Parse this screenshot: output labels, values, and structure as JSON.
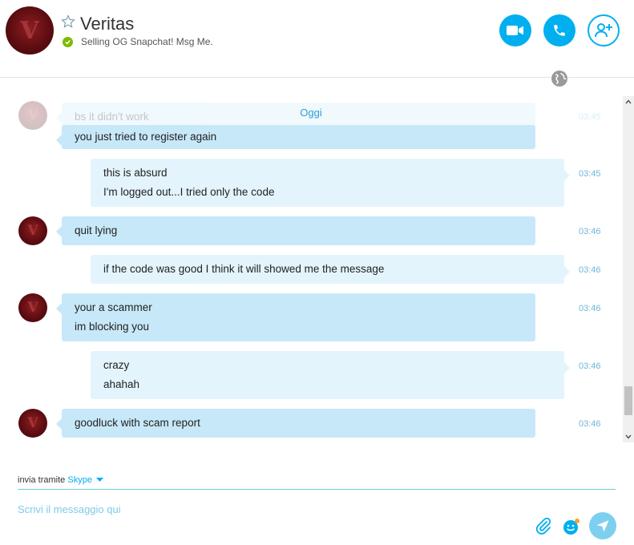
{
  "contact": {
    "name": "Veritas",
    "mood": "Selling OG Snapchat! Msg Me.",
    "avatar_letter": "V",
    "status": "online"
  },
  "header_actions": {
    "video_call": "video-call",
    "audio_call": "audio-call",
    "add_people": "add-people"
  },
  "chat": {
    "day_separator": "Oggi",
    "messages": [
      {
        "dir": "in",
        "lines": [
          "bs it didn't work"
        ],
        "time": "03:45",
        "faded": true
      },
      {
        "dir": "in",
        "lines": [
          "you just tried to register again"
        ],
        "time": ""
      },
      {
        "dir": "out",
        "lines": [
          "this is absurd",
          "I'm logged out...I tried only the code"
        ],
        "time": "03:45"
      },
      {
        "dir": "in",
        "lines": [
          "quit lying"
        ],
        "time": "03:46"
      },
      {
        "dir": "out",
        "lines": [
          "if the code was good I think it will showed me the message"
        ],
        "time": "03:46"
      },
      {
        "dir": "in",
        "lines": [
          "your a scammer",
          "im blocking you"
        ],
        "time": "03:46"
      },
      {
        "dir": "out",
        "lines": [
          "crazy",
          "ahahah"
        ],
        "time": "03:46"
      },
      {
        "dir": "in",
        "lines": [
          "goodluck with scam report"
        ],
        "time": "03:46"
      }
    ]
  },
  "composer": {
    "via_label": "invia tramite",
    "via_service": "Skype",
    "placeholder": "Scrivi il messaggio qui"
  },
  "colors": {
    "accent": "#00aff0",
    "incoming_bubble": "#c7e8f8",
    "outgoing_bubble": "#e3f4fc",
    "online": "#7dbb00"
  }
}
